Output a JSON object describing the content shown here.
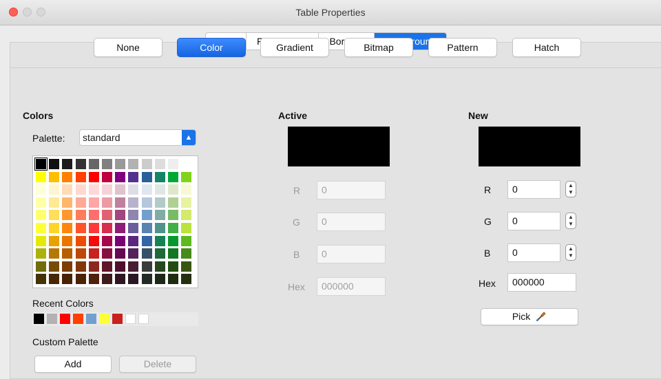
{
  "window": {
    "title": "Table Properties"
  },
  "tabs": [
    {
      "label": "Font",
      "selected": false
    },
    {
      "label": "Font Effects",
      "selected": false
    },
    {
      "label": "Borders",
      "selected": false
    },
    {
      "label": "Background",
      "selected": true
    }
  ],
  "fill_types": [
    {
      "label": "None",
      "selected": false
    },
    {
      "label": "Color",
      "selected": true
    },
    {
      "label": "Gradient",
      "selected": false
    },
    {
      "label": "Bitmap",
      "selected": false
    },
    {
      "label": "Pattern",
      "selected": false
    },
    {
      "label": "Hatch",
      "selected": false
    }
  ],
  "colors": {
    "heading": "Colors",
    "palette_label": "Palette:",
    "palette_value": "standard",
    "grid": [
      [
        "#000000",
        "#111111",
        "#1c1c1c",
        "#333333",
        "#666666",
        "#808080",
        "#999999",
        "#b2b2b2",
        "#cccccc",
        "#dddddd",
        "#eeeeee",
        "#ffffff"
      ],
      [
        "#ffff00",
        "#ffbf00",
        "#ff8000",
        "#ff4000",
        "#ff0000",
        "#bf0041",
        "#800080",
        "#55308d",
        "#2a6099",
        "#158466",
        "#00a933",
        "#81d41a"
      ],
      [
        "#ffffd7",
        "#fff5ce",
        "#ffdbb6",
        "#ffd8ce",
        "#ffd7d7",
        "#f7d1d5",
        "#e0c2cd",
        "#dedce6",
        "#dee6ef",
        "#dee7e5",
        "#dde8cb",
        "#f6f9d4"
      ],
      [
        "#ffffa6",
        "#ffe994",
        "#ffb66c",
        "#ffaa95",
        "#ffa6a6",
        "#ec9ba4",
        "#bf819e",
        "#b7b3ca",
        "#b4c7dc",
        "#b3cac7",
        "#afd095",
        "#e8f2a1"
      ],
      [
        "#ffff6d",
        "#ffde59",
        "#ff972f",
        "#ff7b59",
        "#ff6d6d",
        "#e16173",
        "#a1467e",
        "#8e86ae",
        "#729fcf",
        "#81aca6",
        "#77bc65",
        "#d4ea6b"
      ],
      [
        "#ffff38",
        "#ffd428",
        "#ff860d",
        "#ff5429",
        "#ff3838",
        "#d62e4e",
        "#8d1d75",
        "#6b5e9b",
        "#5983b0",
        "#50938a",
        "#3faf46",
        "#bbe33d"
      ],
      [
        "#e6e905",
        "#e8a202",
        "#ea7500",
        "#ed4c05",
        "#f10d0c",
        "#a7074b",
        "#780373",
        "#5b277d",
        "#3465a4",
        "#168253",
        "#069a2e",
        "#5eb91e"
      ],
      [
        "#acb20c",
        "#b47804",
        "#b85c00",
        "#be480a",
        "#c9211e",
        "#861141",
        "#650953",
        "#55215b",
        "#355269",
        "#1e6a39",
        "#127622",
        "#468a1a"
      ],
      [
        "#706e0c",
        "#784b04",
        "#7b3d00",
        "#813709",
        "#8d281e",
        "#611729",
        "#4e102d",
        "#481d32",
        "#383d3c",
        "#28471f",
        "#224b12",
        "#395511"
      ],
      [
        "#443205",
        "#472702",
        "#492300",
        "#4b2204",
        "#50200d",
        "#3e1a1d",
        "#321522",
        "#2b1625",
        "#232b26",
        "#1e2818",
        "#1d2c10",
        "#252e0f"
      ]
    ],
    "selected_swatch": "#000000",
    "recent_label": "Recent Colors",
    "recent": [
      "#000000",
      "#b2b2b2",
      "#ff0000",
      "#ff4000",
      "#729fcf",
      "#ffff38",
      "#c9211e",
      "#ffffff",
      "#ffffff"
    ],
    "custom_palette_label": "Custom Palette",
    "add_label": "Add",
    "delete_label": "Delete"
  },
  "active": {
    "heading": "Active",
    "color": "#000000",
    "r_label": "R",
    "r": "0",
    "g_label": "G",
    "g": "0",
    "b_label": "B",
    "b": "0",
    "hex_label": "Hex",
    "hex": "000000"
  },
  "new_color": {
    "heading": "New",
    "color": "#000000",
    "r_label": "R",
    "r": "0",
    "g_label": "G",
    "g": "0",
    "b_label": "B",
    "b": "0",
    "hex_label": "Hex",
    "hex": "000000",
    "pick_label": "Pick"
  },
  "icons": {
    "eyedropper": "eyedropper-icon",
    "spinner": "stepper-icon",
    "select_arrow": "updown-chevron-icon"
  }
}
